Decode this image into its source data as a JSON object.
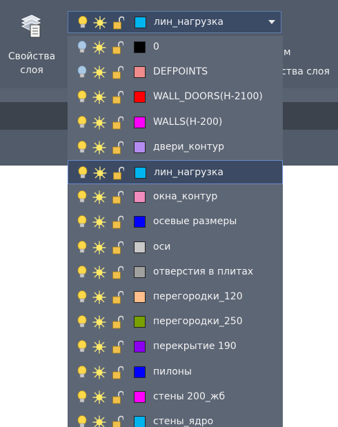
{
  "ribbon": {
    "layer_properties_label_line1": "Свойства",
    "layer_properties_label_line2": "слоя",
    "partial_label_top": "м",
    "partial_label_mid": "йства слоя"
  },
  "combo": {
    "current_layer": "лин_нагрузка",
    "current_color": "#00b4f0"
  },
  "layers": [
    {
      "name": "0",
      "color": "#000000",
      "bulb_on": false
    },
    {
      "name": "DEFPOINTS",
      "color": "#f08c8c",
      "bulb_on": false
    },
    {
      "name": "WALL_DOORS(H-2100)",
      "color": "#ff0000",
      "bulb_on": true
    },
    {
      "name": "WALLS(H-200)",
      "color": "#ff00ff",
      "bulb_on": true
    },
    {
      "name": "двери_контур",
      "color": "#b48cf0",
      "bulb_on": true
    },
    {
      "name": "лин_нагрузка",
      "color": "#00b4f0",
      "bulb_on": true,
      "selected": true
    },
    {
      "name": "окна_контур",
      "color": "#f08cbe",
      "bulb_on": true
    },
    {
      "name": "осевые размеры",
      "color": "#0000ff",
      "bulb_on": true
    },
    {
      "name": "оси",
      "color": "#c8c8c8",
      "bulb_on": true
    },
    {
      "name": "отверстия в плитах",
      "color": "#a0a0a0",
      "bulb_on": true
    },
    {
      "name": "перегородки_120",
      "color": "#ffbe8c",
      "bulb_on": true
    },
    {
      "name": "перегородки_250",
      "color": "#78a000",
      "bulb_on": true
    },
    {
      "name": "перекрытие 190",
      "color": "#8c00f0",
      "bulb_on": true
    },
    {
      "name": "пилоны",
      "color": "#0000ff",
      "bulb_on": true
    },
    {
      "name": "стены 200_жб",
      "color": "#ff00ff",
      "bulb_on": true
    },
    {
      "name": "стены_ядро",
      "color": "#00b4f0",
      "bulb_on": true
    }
  ],
  "icons": {
    "bulb": "lightbulb-icon",
    "sun": "freeze-sun-icon",
    "lock": "unlocked-padlock-icon"
  }
}
